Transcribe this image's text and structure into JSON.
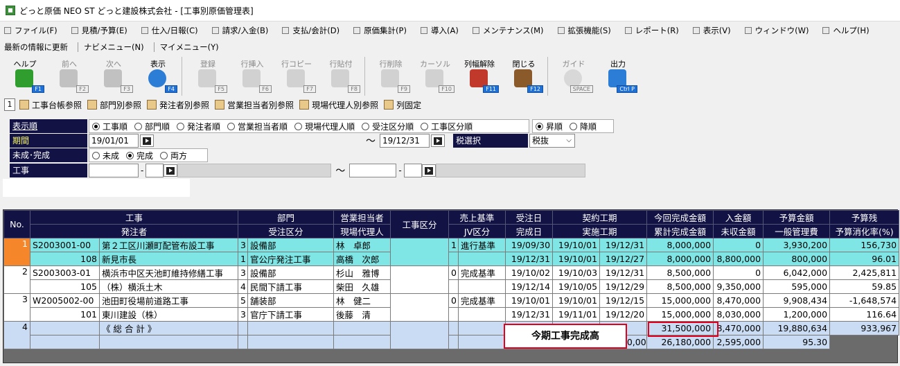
{
  "window": {
    "title": "どっと原価 NEO ST どっと建設株式会社 - [工事別原価管理表]"
  },
  "menu": [
    "ファイル(F)",
    "見積/予算(E)",
    "仕入/日報(C)",
    "請求/入金(B)",
    "支払/会計(D)",
    "原価集計(P)",
    "導入(A)",
    "メンテナンス(M)",
    "拡張機能(S)",
    "レポート(R)",
    "表示(V)",
    "ウィンドウ(W)",
    "ヘルプ(H)"
  ],
  "links": {
    "refresh": "最新の情報に更新",
    "navi": "ナビメニュー(N)",
    "my": "マイメニュー(Y)"
  },
  "toolbar": [
    {
      "label": "ヘルプ",
      "key": "F1"
    },
    {
      "label": "前へ",
      "key": "F2"
    },
    {
      "label": "次へ",
      "key": "F3"
    },
    {
      "label": "表示",
      "key": "F4"
    },
    {
      "label": "登録",
      "key": "F5"
    },
    {
      "label": "行挿入",
      "key": "F6"
    },
    {
      "label": "行コピー",
      "key": "F7"
    },
    {
      "label": "行貼付",
      "key": "F8"
    },
    {
      "label": "行削除",
      "key": "F9"
    },
    {
      "label": "カーソル",
      "key": "F10"
    },
    {
      "label": "列幅解除",
      "key": "F11"
    },
    {
      "label": "閉じる",
      "key": "F12"
    },
    {
      "label": "ガイド",
      "key": "SPACE"
    },
    {
      "label": "出力",
      "key": "Ctrl P"
    }
  ],
  "nav": {
    "num": "1",
    "items": [
      "工事台帳参照",
      "部門別参照",
      "発注者別参照",
      "営業担当者別参照",
      "現場代理人別参照",
      "列固定"
    ]
  },
  "filters": {
    "order_label": "表示順",
    "order_options": [
      "工事順",
      "部門順",
      "発注者順",
      "営業担当者順",
      "現場代理人順",
      "受注区分順",
      "工事区分順"
    ],
    "dir_options": [
      "昇順",
      "降順"
    ],
    "period_label": "期間",
    "period_from": "19/01/01",
    "tilde": "～",
    "period_to": "19/12/31",
    "tax_label": "税選択",
    "tax_value": "税抜",
    "status_label": "未成･完成",
    "status_options": [
      "未成",
      "完成",
      "両方"
    ],
    "kouji_label": "工事",
    "dash": "-"
  },
  "grid": {
    "headers_top": [
      "No.",
      "工事",
      "部門",
      "営業担当者",
      "工事区分",
      "売上基準",
      "受注日",
      "契約工期",
      "今回完成金額",
      "入金額",
      "予算金額",
      "予算残"
    ],
    "headers_bottom": [
      "発注者",
      "受注区分",
      "現場代理人",
      "JV区分",
      "完成日",
      "実施工期",
      "累計完成金額",
      "未収金額",
      "一般管理費",
      "予算消化率(%)"
    ],
    "rows": [
      {
        "no": "1",
        "code": "S2003001-00",
        "name": "第２工区川瀬町配管布設工事",
        "dept_no": "3",
        "dept": "設備部",
        "sales": "林　卓郎",
        "kubun": "",
        "jv_no": "1",
        "kijun": "進行基準",
        "order_date": "19/09/30",
        "start": "19/10/01",
        "end": "19/12/31",
        "amount": "8,000,000",
        "nyukin": "0",
        "budget": "3,930,200",
        "zan": "156,730",
        "client_no": "108",
        "client": "新見市長",
        "juchu_no": "1",
        "juchu": "官公庁発注工事",
        "agent": "高橋　次郎",
        "jv": "",
        "done": "19/12/31",
        "jstart": "19/10/01",
        "jend": "19/12/27",
        "ruikei": "8,000,000",
        "mishu": "8,800,000",
        "kanri": "800,000",
        "rate": "96.01"
      },
      {
        "no": "2",
        "code": "S2003003-01",
        "name": "横浜市中区天池町維持修繕工事",
        "dept_no": "3",
        "dept": "設備部",
        "sales": "杉山　雅博",
        "kubun": "",
        "jv_no": "0",
        "kijun": "完成基準",
        "order_date": "19/10/02",
        "start": "19/10/03",
        "end": "19/12/31",
        "amount": "8,500,000",
        "nyukin": "0",
        "budget": "6,042,000",
        "zan": "2,425,811",
        "client_no": "105",
        "client": "（株）横浜土木",
        "juchu_no": "4",
        "juchu": "民間下請工事",
        "agent": "柴田　久雄",
        "jv": "",
        "done": "19/12/14",
        "jstart": "19/10/05",
        "jend": "19/12/29",
        "ruikei": "8,500,000",
        "mishu": "9,350,000",
        "kanri": "595,000",
        "rate": "59.85"
      },
      {
        "no": "3",
        "code": "W2005002-00",
        "name": "池田町役場前道路工事",
        "dept_no": "5",
        "dept": "舗装部",
        "sales": "林　健二",
        "kubun": "",
        "jv_no": "0",
        "kijun": "完成基準",
        "order_date": "19/10/01",
        "start": "19/10/01",
        "end": "19/12/15",
        "amount": "15,000,000",
        "nyukin": "8,470,000",
        "budget": "9,908,434",
        "zan": "-1,648,574",
        "client_no": "101",
        "client": "東川建設（株）",
        "juchu_no": "3",
        "juchu": "官庁下請工事",
        "agent": "後藤　清",
        "jv": "",
        "done": "19/12/31",
        "jstart": "19/11/01",
        "jend": "19/12/20",
        "ruikei": "15,000,000",
        "mishu": "8,030,000",
        "kanri": "1,200,000",
        "rate": "116.64"
      }
    ],
    "total": {
      "no": "4",
      "label": "《 総 合 計 》",
      "amount": "31,500,000",
      "nyukin": "8,470,000",
      "budget": "19,880,634",
      "zan": "933,967",
      "ruikei": "31,500,000",
      "mishu": "26,180,000",
      "kanri": "2,595,000",
      "rate": "95.30"
    }
  },
  "annotation": "今期工事完成高"
}
